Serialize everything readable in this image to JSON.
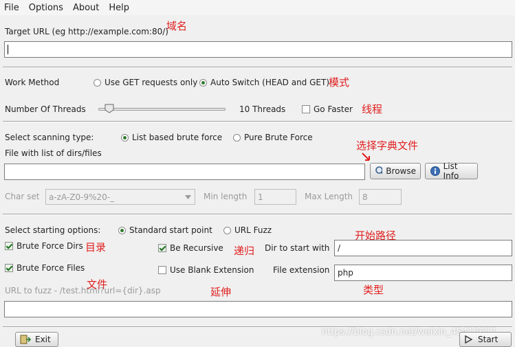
{
  "menu": {
    "file": "File",
    "options": "Options",
    "about": "About",
    "help": "Help"
  },
  "target": {
    "label": "Target URL (eg http://example.com:80/)",
    "value": "",
    "note": "域名"
  },
  "work": {
    "label": "Work Method",
    "get_only": "Use GET requests only",
    "auto": "Auto Switch (HEAD and GET)",
    "selected": "auto",
    "note": "模式"
  },
  "threads": {
    "label": "Number Of Threads",
    "value_text": "10 Threads",
    "go_faster": "Go Faster",
    "go_faster_checked": false,
    "note": "线程",
    "level": 0.08
  },
  "scan": {
    "label": "Select scanning type:",
    "list_based": "List based brute force",
    "pure": "Pure Brute Force",
    "selected": "list_based",
    "file_label": "File with list of dirs/files",
    "file_value": "",
    "browse": "Browse",
    "list_info": "List Info",
    "note": "选择字典文件"
  },
  "charset": {
    "label": "Char set",
    "value": "a-zA-Z0-9%20-_",
    "min_label": "Min length",
    "min_value": "1",
    "max_label": "Max Length",
    "max_value": "8"
  },
  "start": {
    "label": "Select starting options:",
    "standard": "Standard start point",
    "url_fuzz": "URL Fuzz",
    "selected": "standard",
    "note": "开始路径"
  },
  "options": {
    "brute_dirs": "Brute Force Dirs",
    "brute_dirs_checked": true,
    "brute_dirs_note": "目录",
    "recursive": "Be Recursive",
    "recursive_checked": true,
    "recursive_note": "递归",
    "dir_start_label": "Dir to start with",
    "dir_start_value": "/",
    "brute_files": "Brute Force Files",
    "brute_files_checked": true,
    "brute_files_note": "文件",
    "blank_ext": "Use Blank Extension",
    "blank_ext_checked": false,
    "blank_ext_note": "延伸",
    "file_ext_label": "File extension",
    "file_ext_value": "php",
    "file_ext_note": "类型"
  },
  "fuzz": {
    "label": "URL to fuzz - /test.html?url={dir}.asp",
    "value": ""
  },
  "footer": {
    "exit": "Exit",
    "start": "Start",
    "watermark": "https://blog.csdn.net/weixin_45416657"
  }
}
